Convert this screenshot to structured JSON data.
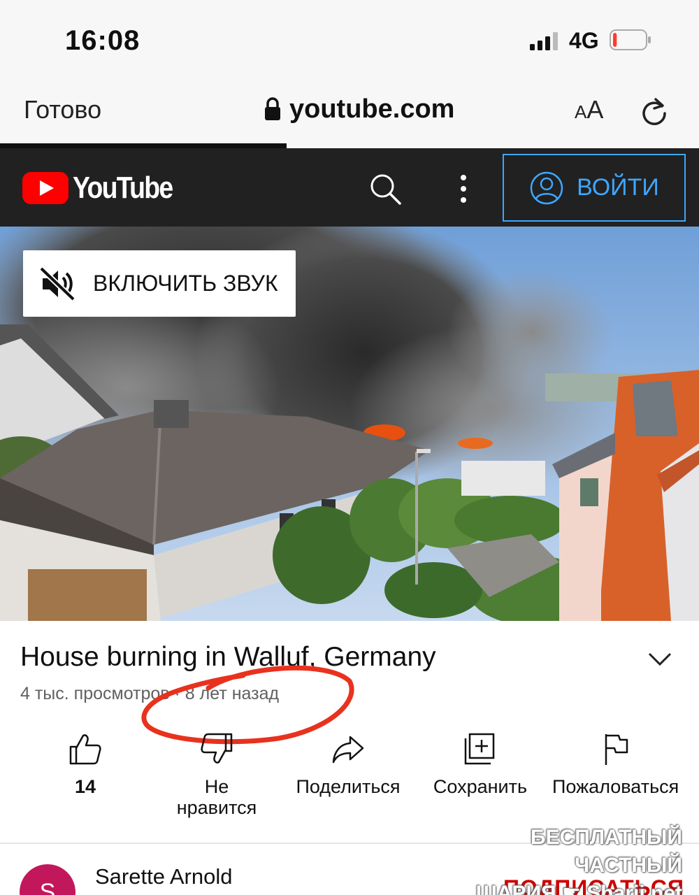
{
  "status_bar": {
    "time": "16:08",
    "network": "4G",
    "battery_level": 0.12,
    "battery_color": "#ff3b30"
  },
  "browser": {
    "done_label": "Готово",
    "url": "youtube.com",
    "text_size_label_small": "A",
    "text_size_label_large": "A",
    "load_progress": 0.41
  },
  "youtube_header": {
    "logo_text": "YouTube",
    "signin_label": "ВОЙТИ",
    "accent_color": "#3ea6ff",
    "brand_color": "#ff0000"
  },
  "video": {
    "unmute_label": "ВКЛЮЧИТЬ ЗВУК"
  },
  "video_info": {
    "title": "House burning in Walluf, Germany",
    "meta": "4 тыс. просмотров · 8 лет назад",
    "annotation_color": "#e8321e"
  },
  "actions": [
    {
      "icon": "thumb-up-icon",
      "label": "14"
    },
    {
      "icon": "thumb-down-icon",
      "label_line1": "Не",
      "label_line2": "нравится"
    },
    {
      "icon": "share-icon",
      "label": "Поделиться"
    },
    {
      "icon": "save-playlist-icon",
      "label": "Сохранить"
    },
    {
      "icon": "flag-icon",
      "label": "Пожаловаться"
    }
  ],
  "channel": {
    "avatar_letter": "S",
    "name": "Sarette Arnold",
    "subscribe_label": "ПОДПИСАТЬСЯ"
  },
  "watermark": {
    "line1": "БЕСПЛАТНЫЙ ЧАСТНЫЙ",
    "line2": "ШАРИЯ",
    "line2_icon": "pointing-hand-icon",
    "line2_suffix": "Sharij.net"
  }
}
